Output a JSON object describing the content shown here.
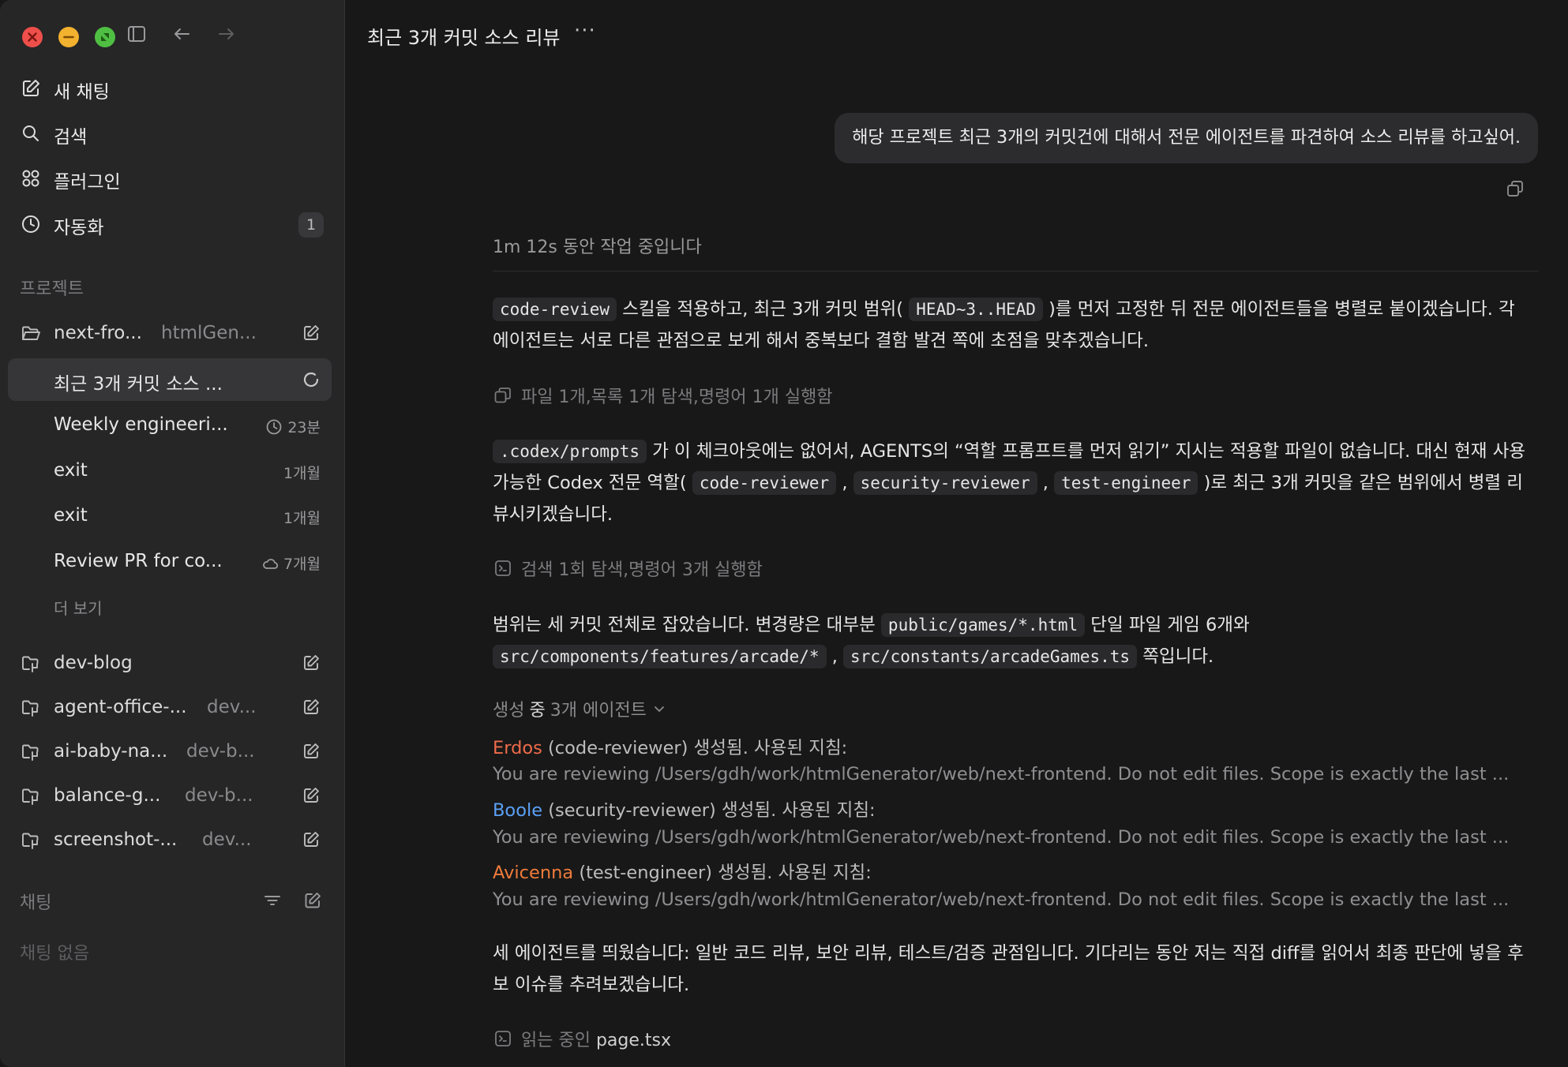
{
  "sidebar": {
    "nav": [
      {
        "label": "새 채팅",
        "icon": "compose-icon"
      },
      {
        "label": "검색",
        "icon": "search-icon"
      },
      {
        "label": "플러그인",
        "icon": "plugins-icon"
      },
      {
        "label": "자동화",
        "icon": "clock-icon",
        "badge": "1"
      }
    ],
    "projects_label": "프로젝트",
    "projects": [
      {
        "name": "next-fro...",
        "sub": "htmlGen..."
      },
      {
        "name": "dev-blog",
        "sub": ""
      },
      {
        "name": "agent-office-...",
        "sub": "dev..."
      },
      {
        "name": "ai-baby-na...",
        "sub": "dev-b..."
      },
      {
        "name": "balance-g...",
        "sub": "dev-b..."
      },
      {
        "name": "screenshot-...",
        "sub": "dev..."
      }
    ],
    "threads": [
      {
        "name": "최근 3개 커밋 소스 ...",
        "meta": ""
      },
      {
        "name": "Weekly engineeri...",
        "meta": "23분"
      },
      {
        "name": "exit",
        "meta": "1개월"
      },
      {
        "name": "exit",
        "meta": "1개월"
      },
      {
        "name": "Review PR for co...",
        "meta": "7개월"
      }
    ],
    "more_label": "더 보기",
    "chats_label": "채팅",
    "no_chats": "채팅 없음"
  },
  "main": {
    "title": "최근 3개 커밋 소스 리뷰",
    "more": "···",
    "user_message": "해당 프로젝트 최근 3개의 커밋건에 대해서 전문 에이전트를 파견하여 소스 리뷰를 하고싶어.",
    "working": "1m 12s 동안 작업 중입니다",
    "p1": {
      "c1": "code-review",
      "t1": " 스킬을 적용하고, 최근 3개 커밋 범위( ",
      "c2": "HEAD~3..HEAD",
      "t2": " )를 먼저 고정한 뒤 전문 에이전트들을 병렬로 붙이겠습니다. 각 에이전트는 서로 다른 관점으로 보게 해서 중복보다 결함 발견 쪽에 초점을 맞추겠습니다."
    },
    "activity1": "파일 1개,목록 1개 탐색,명령어 1개 실행함",
    "p2": {
      "c1": ".codex/prompts",
      "t1": " 가 이 체크아웃에는 없어서, AGENTS의 “역할 프롬프트를 먼저 읽기” 지시는 적용할 파일이 없습니다. 대신 현재 사용 가능한 Codex 전문 역할( ",
      "c2": "code-reviewer",
      "t2": " , ",
      "c3": "security-reviewer",
      "t3": " , ",
      "c4": "test-engineer",
      "t4": " )로 최근 3개 커밋을 같은 범위에서 병렬 리뷰시키겠습니다."
    },
    "activity2": "검색 1회 탐색,명령어 3개 실행함",
    "p3": {
      "t1": "범위는 세 커밋 전체로 잡았습니다. 변경량은 대부분 ",
      "c1": "public/games/*.html",
      "t2": " 단일 파일 게임 6개와 ",
      "c2": "src/components/features/arcade/*",
      "t3": " , ",
      "c3": "src/constants/arcadeGames.ts",
      "t4": " 쪽입니다."
    },
    "agents_head_prefix": "생성 ",
    "agents_head_bold": "중",
    "agents_head_rest": "3개 에이전트",
    "agents": [
      {
        "name": "Erdos",
        "role": " (code-reviewer) 생성됨. 사용된 지침:",
        "desc": "You are reviewing /Users/gdh/work/htmlGenerator/web/next-frontend. Do not edit files. Scope is exactly the last ..."
      },
      {
        "name": "Boole",
        "role": " (security-reviewer) 생성됨. 사용된 지침:",
        "desc": "You are reviewing /Users/gdh/work/htmlGenerator/web/next-frontend. Do not edit files. Scope is exactly the last ..."
      },
      {
        "name": "Avicenna",
        "role": " (test-engineer) 생성됨. 사용된 지침:",
        "desc": "You are reviewing /Users/gdh/work/htmlGenerator/web/next-frontend. Do not edit files. Scope is exactly the last ..."
      }
    ],
    "p4": "세 에이전트를 띄웠습니다: 일반 코드 리뷰, 보안 리뷰, 테스트/검증 관점입니다. 기다리는 동안 저는 직접 diff를 읽어서 최종 판단에 넣을 후보 이슈를 추려보겠습니다.",
    "activity3_prefix": "읽는 중인 ",
    "activity3_file": "page.tsx"
  }
}
